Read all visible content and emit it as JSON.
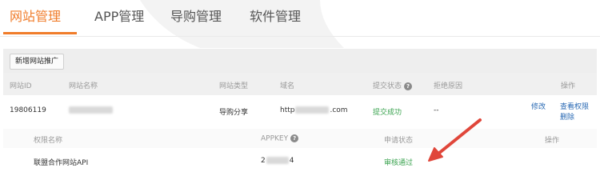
{
  "tabs": [
    {
      "label": "网站管理",
      "active": true
    },
    {
      "label": "APP管理",
      "active": false
    },
    {
      "label": "导购管理",
      "active": false
    },
    {
      "label": "软件管理",
      "active": false
    }
  ],
  "toolbar": {
    "add_label": "新增网站推广"
  },
  "table": {
    "headers": {
      "site_id": "网站ID",
      "site_name": "网站名称",
      "site_type": "网站类型",
      "domain": "域名",
      "submit_status": "提交状态",
      "reject_reason": "拒绝原因",
      "actions": "操作"
    },
    "rows": [
      {
        "site_id": "19806119",
        "site_name": "",
        "site_type": "导购分享",
        "domain_prefix": "http",
        "domain_suffix": ".com",
        "submit_status": "提交成功",
        "reject_reason": "--",
        "edit": "修改",
        "view_permission": "查看权限",
        "delete": "删除"
      }
    ]
  },
  "sub_table": {
    "headers": {
      "perm_name": "权限名称",
      "appkey": "APPKEY",
      "apply_status": "申请状态",
      "actions": "操作"
    },
    "rows": [
      {
        "perm_name": "联盟合作网站API",
        "appkey_prefix": "2",
        "appkey_suffix": "4",
        "apply_status": "审核通过"
      }
    ]
  },
  "colors": {
    "accent": "#f07c2a",
    "link": "#2a6ab4",
    "success": "#3aa34f",
    "arrow": "#e0463a"
  },
  "icons": [
    "help-icon",
    "arrow-annotation"
  ]
}
